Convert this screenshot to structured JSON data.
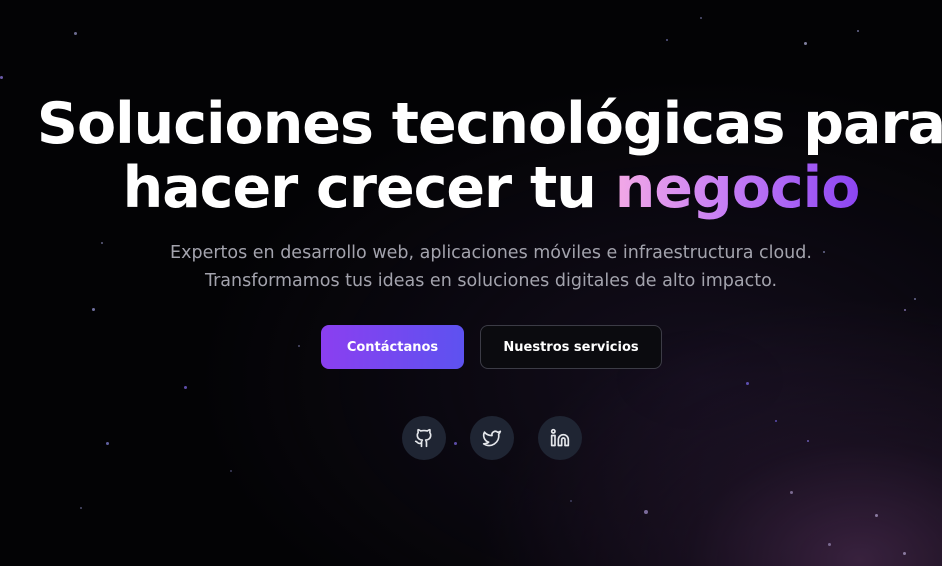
{
  "hero": {
    "headline_line1": "Soluciones tecnológicas para",
    "headline_line2_prefix": "hacer crecer tu ",
    "headline_accent": "negocio",
    "subtitle_line1": "Expertos en desarrollo web, aplicaciones móviles e infraestructura cloud.",
    "subtitle_line2": "Transformamos tus ideas en soluciones digitales de alto impacto."
  },
  "actions": {
    "primary_label": "Contáctanos",
    "secondary_label": "Nuestros servicios"
  },
  "social": {
    "items": [
      {
        "icon": "github-icon"
      },
      {
        "icon": "twitter-icon"
      },
      {
        "icon": "linkedin-icon"
      }
    ]
  },
  "colors": {
    "background": "#030305",
    "primary_gradient_start": "#8b3ff0",
    "primary_gradient_end": "#5d52f0",
    "accent_gradient_start": "#f3a9e6",
    "accent_gradient_end": "#8b45f2",
    "social_button_bg": "#1f2533",
    "subtitle_text": "#a3a3ad"
  }
}
